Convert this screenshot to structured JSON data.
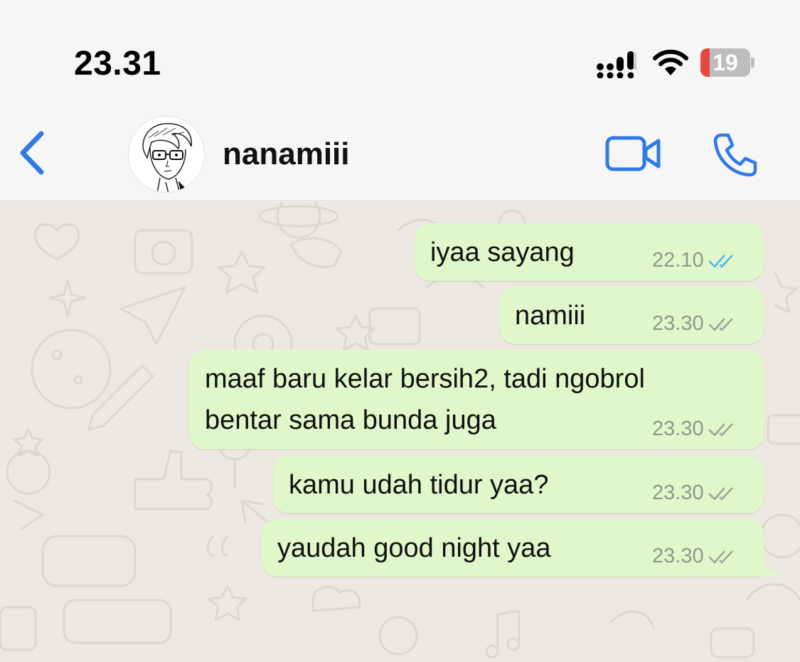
{
  "status_bar": {
    "time": "23.31",
    "battery_percent": "19",
    "battery_level": 0.19,
    "battery_color": "#e5483c",
    "icons": [
      "signal-icon",
      "wifi-icon",
      "battery-icon"
    ]
  },
  "header": {
    "back_icon": "chevron-left-icon",
    "contact_name": "nanamiii",
    "actions": [
      "video-camera-icon",
      "phone-icon"
    ],
    "accent_color": "#2f7ae5"
  },
  "messages": [
    {
      "text_lines": [
        "iyaa sayang"
      ],
      "time": "22.10",
      "status": "read",
      "tick_color": "#4fb6ec"
    },
    {
      "text_lines": [
        "namiii"
      ],
      "time": "23.30",
      "status": "delivered",
      "tick_color": "#9aa59a"
    },
    {
      "text_lines": [
        "maaf baru kelar bersih2, tadi ngobrol",
        "bentar sama bunda juga"
      ],
      "time": "23.30",
      "status": "delivered",
      "tick_color": "#9aa59a"
    },
    {
      "text_lines": [
        "kamu udah tidur yaa?"
      ],
      "time": "23.30",
      "status": "delivered",
      "tick_color": "#9aa59a"
    },
    {
      "text_lines": [
        "yaudah good night yaa"
      ],
      "time": "23.30",
      "status": "delivered",
      "tick_color": "#9aa59a"
    }
  ],
  "bubble_color": "#dff7c9",
  "wallpaper_color": "#ece8e1"
}
